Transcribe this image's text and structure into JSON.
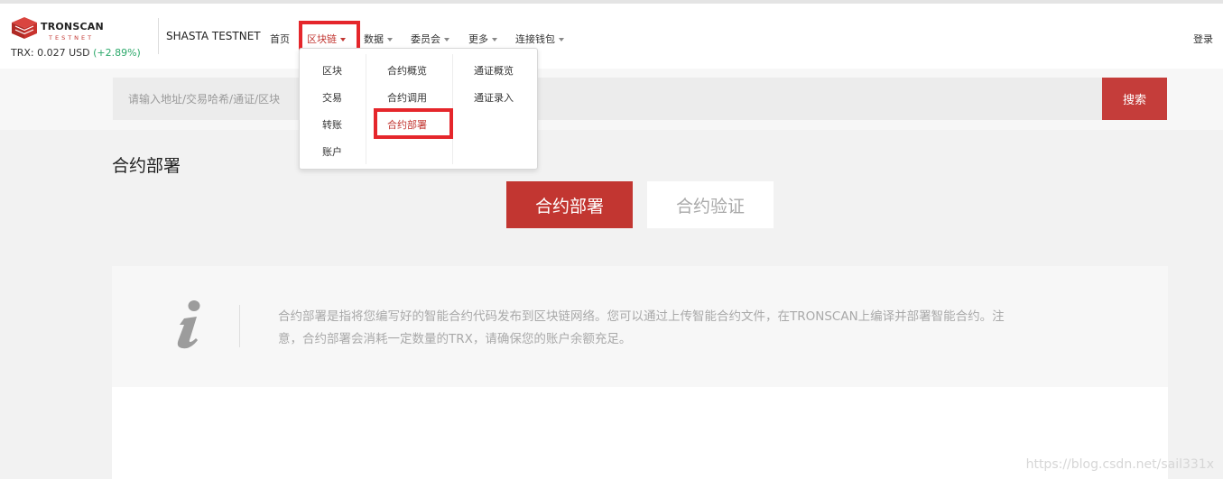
{
  "brand": {
    "name": "TRONSCAN",
    "sub": "TESTNET",
    "price_label": "TRX: 0.027 USD",
    "price_change": "(+2.89%)",
    "network": "SHASTA TESTNET"
  },
  "nav": {
    "home": "首页",
    "blockchain": "区块链",
    "data": "数据",
    "committee": "委员会",
    "more": "更多",
    "wallet": "连接钱包",
    "login": "登录"
  },
  "search": {
    "placeholder": "请输入地址/交易哈希/通证/区块",
    "button": "搜索"
  },
  "dropdown": {
    "col1": [
      "区块",
      "交易",
      "转账",
      "账户"
    ],
    "col2": [
      "合约概览",
      "合约调用",
      "合约部署"
    ],
    "col3": [
      "通证概览",
      "通证录入"
    ]
  },
  "page": {
    "title": "合约部署",
    "tab_deploy": "合约部署",
    "tab_verify": "合约验证",
    "info_line1": "合约部署是指将您编写好的智能合约代码发布到区块链网络。您可以通过上传智能合约文件，在TRONSCAN上编译并部署智能合约。注",
    "info_line2": "意，合约部署会消耗一定数量的TRX，请确保您的账户余额充足。"
  },
  "watermark": "https://blog.csdn.net/sail331x",
  "colors": {
    "accent": "#c23631",
    "highlight": "#e5262b",
    "positive": "#2da96b"
  },
  "icons": {
    "logo": "tron-cube-icon",
    "info": "info-i-icon",
    "caret": "caret-down-icon"
  }
}
